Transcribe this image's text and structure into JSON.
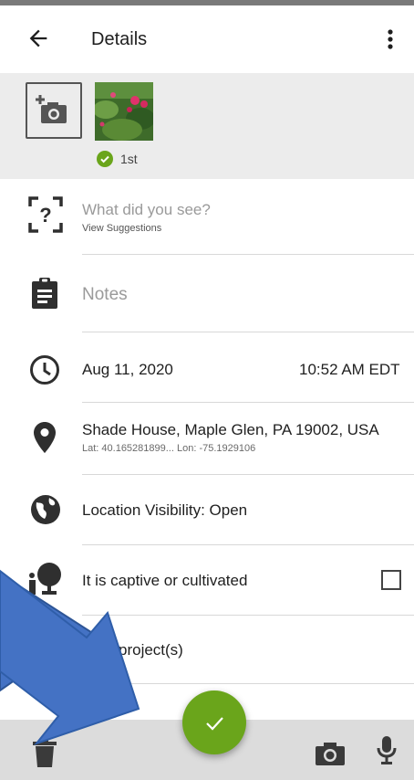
{
  "header": {
    "title": "Details"
  },
  "photos": {
    "badge_label": "1st"
  },
  "species": {
    "placeholder": "What did you see?",
    "suggestions_link": "View Suggestions"
  },
  "notes": {
    "placeholder": "Notes"
  },
  "datetime": {
    "date": "Aug 11, 2020",
    "time": "10:52 AM EDT"
  },
  "location": {
    "name": "Shade House, Maple Glen, PA 19002, USA",
    "coords": "Lat: 40.165281899...   Lon: -75.1929106"
  },
  "visibility": {
    "label": "Location Visibility: Open"
  },
  "captive": {
    "label": "It is captive or cultivated",
    "checked": false
  },
  "projects": {
    "label": "project(s)"
  },
  "colors": {
    "accent": "#6aa51b",
    "annotation_arrow": "#4472c4"
  }
}
